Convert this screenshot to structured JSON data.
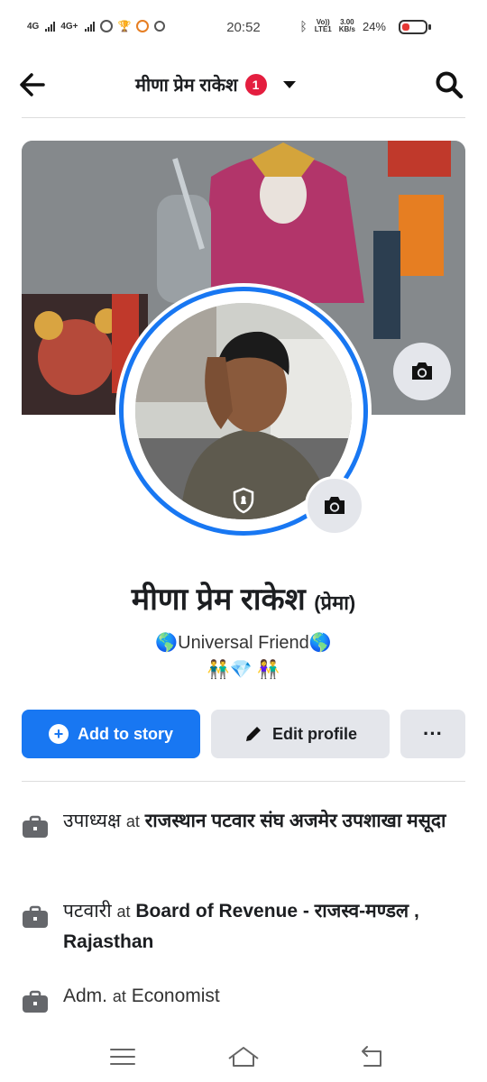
{
  "status_bar": {
    "sim1": "4G",
    "sim2": "4G+",
    "time": "20:52",
    "volte_top": "Vo))",
    "volte_bottom": "LTE1",
    "speed_top": "3.00",
    "speed_bottom": "KB/s",
    "battery": "24%",
    "battery_color": "#e53935"
  },
  "header": {
    "title": "मीणा प्रेम राकेश",
    "notification_count": "1"
  },
  "profile": {
    "name": "मीणा प्रेम राकेश",
    "alt_name": "(प्रेमा)",
    "bio_line1": "🌎Universal Friend🌎",
    "bio_line2": "👬💎 👫"
  },
  "actions": {
    "add_story": "Add to story",
    "edit_profile": "Edit profile",
    "more": "···"
  },
  "work": [
    {
      "role": "उपाध्यक्ष",
      "at": "at",
      "org": "राजस्थान पटवार संघ अजमेर उपशाखा मसूदा"
    },
    {
      "role": "पटवारी",
      "at": "at",
      "org": "Board of Revenue - राजस्व-मण्डल , Rajasthan"
    },
    {
      "role": "Adm.",
      "at": "at",
      "org": "Economist"
    }
  ],
  "colors": {
    "accent": "#1877f2",
    "badge": "#e41e3f",
    "button_gray": "#e4e6eb"
  }
}
